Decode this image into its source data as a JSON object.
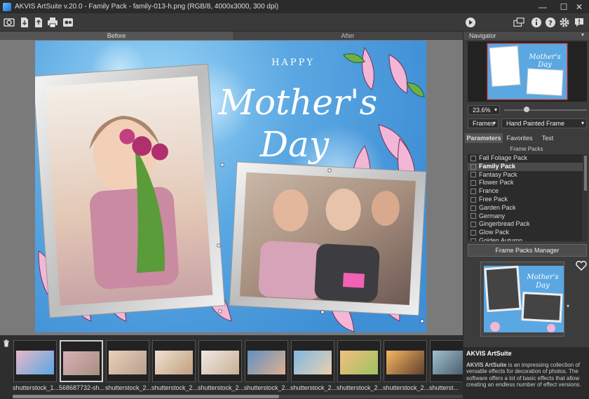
{
  "window": {
    "title": "AKVIS ArtSuite v.20.0 - Family Pack - family-013-h.png (RGB/8, 4000x3000, 300 dpi)",
    "controls": {
      "minimize": "—",
      "maximize": "☐",
      "close": "✕"
    }
  },
  "toolbar": {
    "left_icons": [
      "open-image-icon",
      "save-icon",
      "batch-icon",
      "print-icon",
      "share-icon"
    ],
    "right_icons": [
      "run-icon",
      "workspace-icon",
      "info-icon",
      "help-icon",
      "settings-icon",
      "news-icon"
    ]
  },
  "view_tabs": {
    "before": "Before",
    "after": "After"
  },
  "artwork": {
    "happy": "HAPPY",
    "mothers": "Mother's",
    "day": "Day",
    "colors": {
      "sky": "#5aa7e2",
      "frame": "#e8e8e8",
      "magnolia": "#f3b6d6"
    }
  },
  "filmstrip": {
    "delete_icon": "trash-icon",
    "items": [
      {
        "label": "shutterstock_1..."
      },
      {
        "label": "568687732-sh..."
      },
      {
        "label": "shutterstock_2..."
      },
      {
        "label": "shutterstock_2..."
      },
      {
        "label": "shutterstock_2..."
      },
      {
        "label": "shutterstock_2..."
      },
      {
        "label": "shutterstock_2..."
      },
      {
        "label": "shutterstock_2..."
      },
      {
        "label": "shutterstock_2..."
      },
      {
        "label": "shutterst..."
      }
    ]
  },
  "panel": {
    "navigator_title": "Navigator",
    "zoom": "23.6%",
    "frames_dropdown": "Frames",
    "frame_type_dropdown": "Hand Painted Frame",
    "tabs": [
      "Parameters",
      "Favorites",
      "Text"
    ],
    "frame_packs_label": "Frame Packs",
    "packs": [
      "Fall Foliage Pack",
      "Family Pack",
      "Fantasy Pack",
      "Flower Pack",
      "France",
      "Free Pack",
      "Garden Pack",
      "Germany",
      "Gingerbread Pack",
      "Glow Pack",
      "Golden Autumn"
    ],
    "selected_pack": "Family Pack",
    "manager_button": "Frame Packs Manager",
    "info_title": "AKVIS ArtSuite",
    "info_text_bold": "AKVIS ArtSuite",
    "info_text": " is an impressing collection of versatile effects for decoration of photos. The software offers a lot of basic effects that allow creating an endless number of effect versions."
  }
}
